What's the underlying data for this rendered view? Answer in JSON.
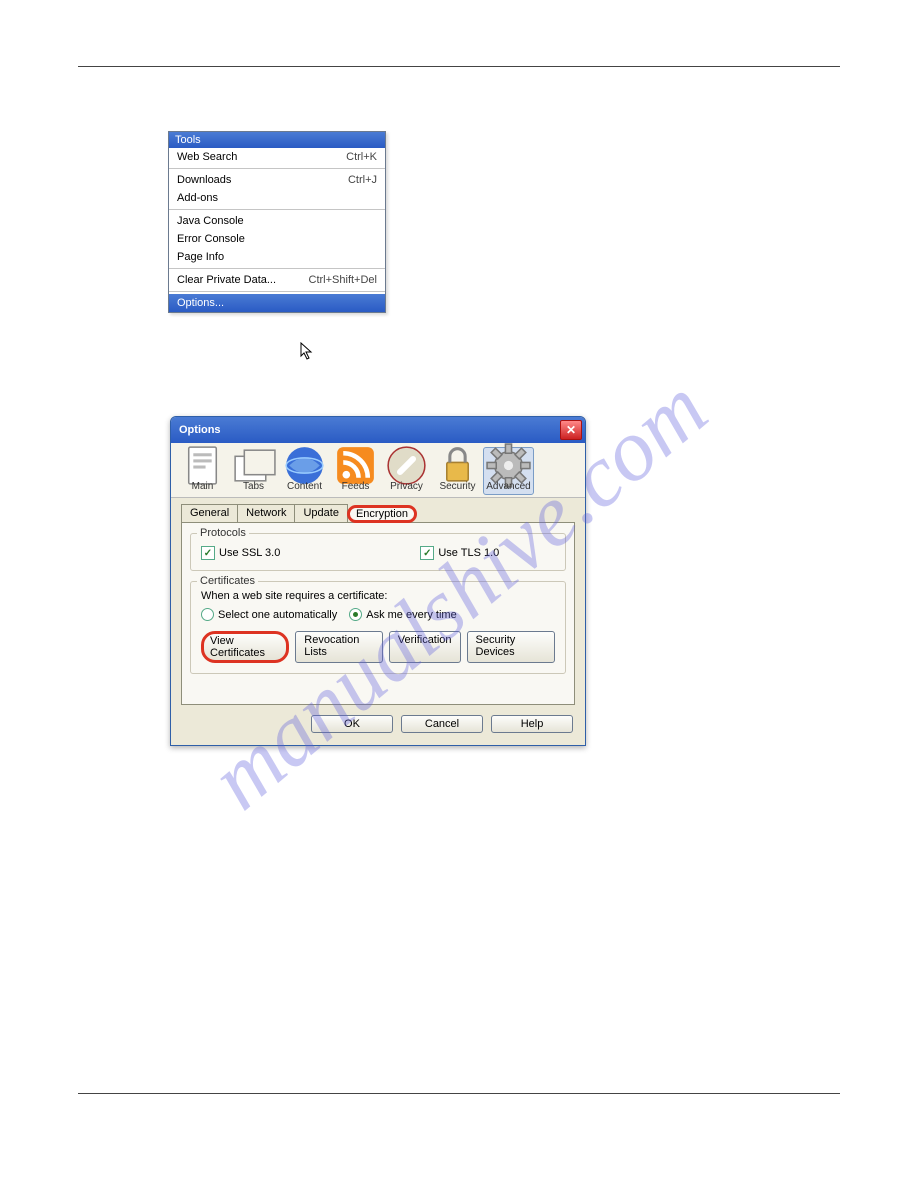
{
  "menu": {
    "title": "Tools",
    "items": [
      {
        "label": "Web Search",
        "shortcut": "Ctrl+K"
      },
      {
        "sep": true
      },
      {
        "label": "Downloads",
        "shortcut": "Ctrl+J"
      },
      {
        "label": "Add-ons"
      },
      {
        "sep": true
      },
      {
        "label": "Java Console"
      },
      {
        "label": "Error Console"
      },
      {
        "label": "Page Info"
      },
      {
        "sep": true
      },
      {
        "label": "Clear Private Data...",
        "shortcut": "Ctrl+Shift+Del"
      },
      {
        "sep": true
      },
      {
        "label": "Options...",
        "selected": true
      }
    ]
  },
  "dialog": {
    "title": "Options",
    "toolbar": [
      {
        "label": "Main",
        "icon": "page"
      },
      {
        "label": "Tabs",
        "icon": "tabs"
      },
      {
        "label": "Content",
        "icon": "globe"
      },
      {
        "label": "Feeds",
        "icon": "feed"
      },
      {
        "label": "Privacy",
        "icon": "priv"
      },
      {
        "label": "Security",
        "icon": "lock"
      },
      {
        "label": "Advanced",
        "icon": "gear",
        "selected": true
      }
    ],
    "tabs": [
      {
        "label": "General"
      },
      {
        "label": "Network"
      },
      {
        "label": "Update"
      },
      {
        "label": "Encryption",
        "selected": true,
        "highlighted": true
      }
    ],
    "protocols": {
      "legend": "Protocols",
      "ssl": "Use SSL 3.0",
      "tls": "Use TLS 1.0"
    },
    "certs": {
      "legend": "Certificates",
      "prompt": "When a web site requires a certificate:",
      "auto": "Select one automatically",
      "ask": "Ask me every time",
      "buttons": [
        {
          "label": "View Certificates",
          "highlighted": true
        },
        {
          "label": "Revocation Lists"
        },
        {
          "label": "Verification"
        },
        {
          "label": "Security Devices"
        }
      ]
    },
    "actions": {
      "ok": "OK",
      "cancel": "Cancel",
      "help": "Help"
    }
  }
}
